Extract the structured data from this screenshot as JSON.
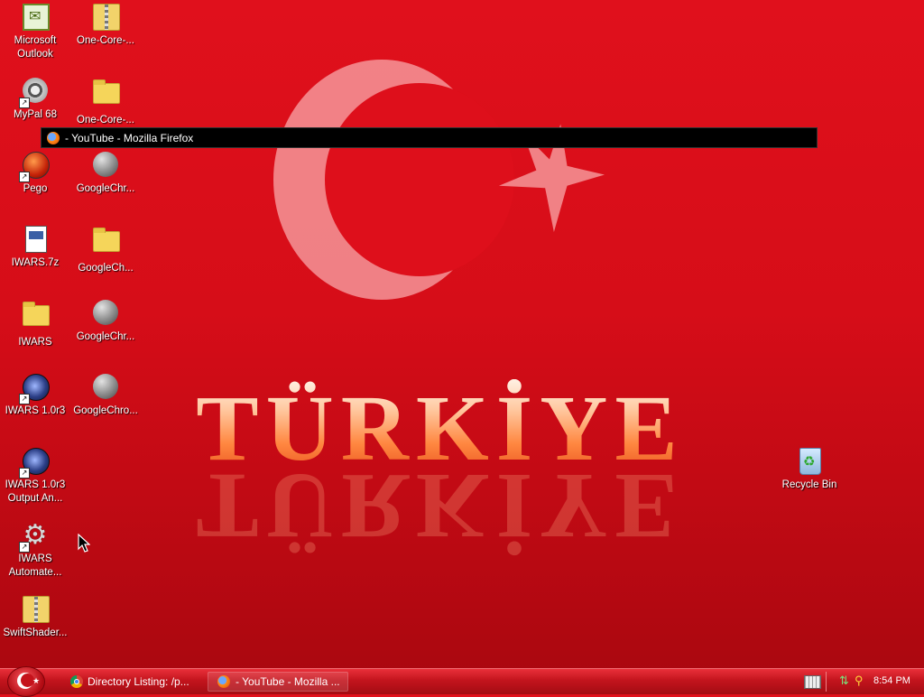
{
  "colors": {
    "wallpaper": "#e0101c",
    "taskbar": "#c3141d",
    "switcher_bg": "#000000"
  },
  "wallpaper": {
    "text": "TÜRKİYE"
  },
  "desktop_icons": [
    {
      "id": "microsoft-outlook",
      "label": "Microsoft Outlook",
      "icon": "outlook-icon",
      "shortcut": false
    },
    {
      "id": "one-core-1",
      "label": "One-Core-...",
      "icon": "zip-folder-icon",
      "shortcut": false
    },
    {
      "id": "mypal-68",
      "label": "MyPal 68",
      "icon": "mypal-icon",
      "shortcut": true
    },
    {
      "id": "one-core-2",
      "label": "One-Core-...",
      "icon": "folder-icon",
      "shortcut": false
    },
    {
      "id": "pego",
      "label": "Pego",
      "icon": "pego-icon",
      "shortcut": true
    },
    {
      "id": "googlechr-1",
      "label": "GoogleChr...",
      "icon": "setup-icon",
      "shortcut": false
    },
    {
      "id": "iwars-7z",
      "label": "IWARS.7z",
      "icon": "archive-file-icon",
      "shortcut": false
    },
    {
      "id": "googlech-2",
      "label": "GoogleCh...",
      "icon": "folder-icon",
      "shortcut": false
    },
    {
      "id": "iwars-folder",
      "label": "IWARS",
      "icon": "folder-icon",
      "shortcut": false
    },
    {
      "id": "googlechr-3",
      "label": "GoogleChr...",
      "icon": "setup-icon",
      "shortcut": false
    },
    {
      "id": "iwars-10r3",
      "label": "IWARS 1.0r3",
      "icon": "iwars-icon",
      "shortcut": true
    },
    {
      "id": "googlechro-4",
      "label": "GoogleChro...",
      "icon": "setup-icon",
      "shortcut": false
    },
    {
      "id": "iwars-output",
      "label": "IWARS 1.0r3 Output An...",
      "icon": "iwars-icon",
      "shortcut": true
    },
    {
      "id": "iwars-automate",
      "label": "IWARS Automate...",
      "icon": "gear-icon",
      "shortcut": true
    },
    {
      "id": "swiftshader",
      "label": "SwiftShader...",
      "icon": "zip-folder-icon",
      "shortcut": false
    },
    {
      "id": "recycle-bin",
      "label": "Recycle Bin",
      "icon": "recycle-bin-icon",
      "shortcut": false
    }
  ],
  "switcher": {
    "title": "- YouTube - Mozilla Firefox",
    "icon": "firefox-icon"
  },
  "taskbar": {
    "start_icon": "start-orb-icon",
    "tasks": [
      {
        "label": "Directory Listing: /p...",
        "icon": "chrome-icon",
        "active": false
      },
      {
        "label": "- YouTube - Mozilla ...",
        "icon": "firefox-icon",
        "active": true
      }
    ],
    "tray_icons": [
      "keyboard-icon",
      "network-icon",
      "search-icon"
    ],
    "clock": "8:54 PM"
  }
}
